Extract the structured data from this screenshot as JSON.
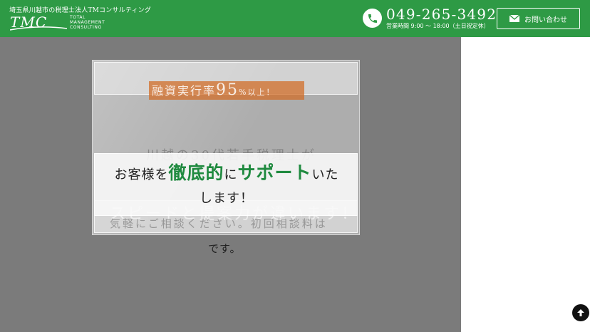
{
  "header": {
    "tagline": "埼玉県川越市の税理士法人TMコンサルティング",
    "logo_mark": "TMC",
    "logo_sub": [
      "TOTAL",
      "MANAGEMENT",
      "CONSULTING"
    ],
    "phone": "049-265-3492",
    "hours": "営業時間 9:00 〜 18:00（土日祝定休）",
    "contact_label": "お問い合わせ",
    "icons": {
      "phone": "phone-icon",
      "mail": "mail-icon"
    }
  },
  "hero": {
    "orange_text": {
      "pre": "融資実行率",
      "num": "95",
      "post": "%以上！"
    },
    "ghost_line1": "川越の30代若手税理士が",
    "ghost_line2": "スピードと提案力が違います！",
    "ghost_line3": "気軽にご相談ください。初回相談料は",
    "message": {
      "p1": "お客様を",
      "em1": "徹底的",
      "p2": "に",
      "em2": "サポート",
      "p3": "いた",
      "p4": "します！"
    },
    "tail": "です。"
  },
  "colors": {
    "brand": "#2e9a45",
    "accent_text": "#1f8a3f"
  },
  "back_to_top": {
    "icon": "arrow-up-icon"
  }
}
